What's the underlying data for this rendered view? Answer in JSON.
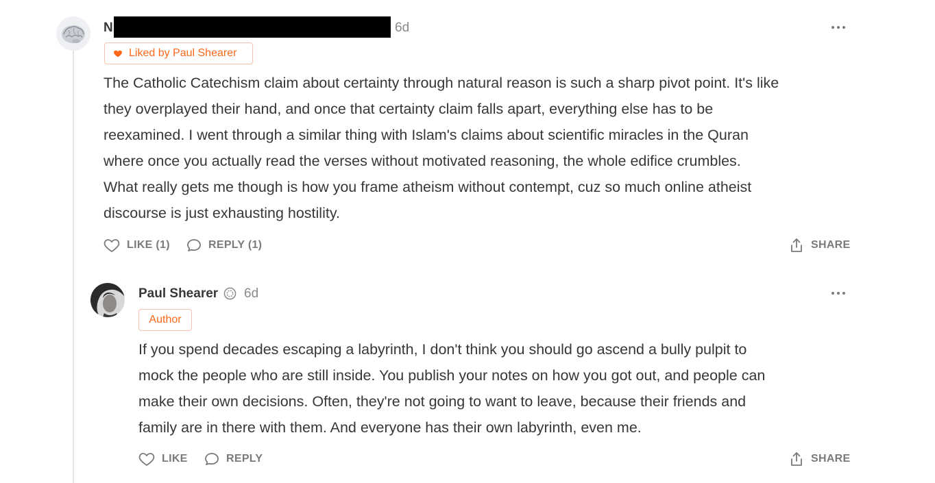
{
  "comments": [
    {
      "author_initial": "N",
      "time": "6d",
      "liked_badge": "Liked by Paul Shearer",
      "paragraph_lines": [
        "The Catholic Catechism claim about certainty through natural reason is such a sharp pivot point. It's like",
        "they overplayed their hand, and once that certainty claim falls apart, everything else has to be",
        "reexamined. I went through a similar thing with Islam's claims about scientific miracles in the Quran",
        "where once you actually read the verses without motivated reasoning, the whole edifice crumbles.",
        "What really gets me though is how you frame atheism without contempt, cuz so much online atheist",
        "discourse is just exhausting hostility."
      ],
      "like_label": "LIKE (1)",
      "reply_label": "REPLY (1)",
      "share_label": "SHARE"
    },
    {
      "author": "Paul Shearer",
      "time": "6d",
      "author_badge": "Author",
      "paragraph_lines": [
        "If you spend decades escaping a labyrinth, I don't think you should go ascend a bully pulpit to",
        "mock the people who are still inside. You publish your notes on how you got out, and people can",
        "make their own decisions. Often, they're not going to want to leave, because their friends and",
        "family are in there with them. And everyone has their own labyrinth, even me."
      ],
      "like_label": "LIKE",
      "reply_label": "REPLY",
      "share_label": "SHARE"
    }
  ],
  "colors": {
    "accent": "#ff6719",
    "text": "#363737",
    "muted": "#7a7a7a",
    "thread_line": "#e6e6e6",
    "redaction": "#000000"
  },
  "icons": [
    "heart-icon",
    "like-icon",
    "reply-icon",
    "share-icon",
    "more-icon",
    "verified-icon"
  ]
}
